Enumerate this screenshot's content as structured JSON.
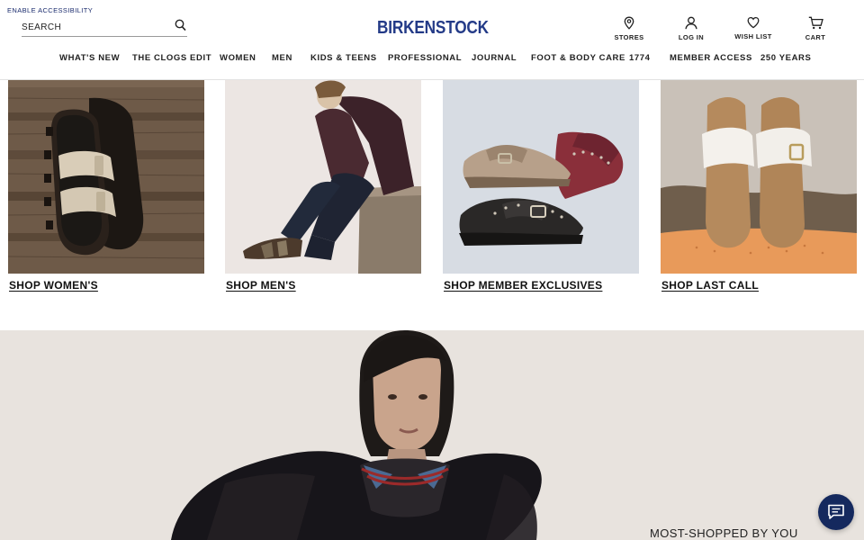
{
  "header": {
    "accessibility_link": "ENABLE ACCESSIBILITY",
    "search_placeholder": "SEARCH",
    "logo_text": "BIRKENSTOCK",
    "utility": [
      {
        "label": "STORES",
        "icon": "location-pin-icon"
      },
      {
        "label": "LOG IN",
        "icon": "user-icon"
      },
      {
        "label": "WISH LIST",
        "icon": "heart-icon"
      },
      {
        "label": "CART",
        "icon": "cart-icon"
      }
    ]
  },
  "nav": {
    "items": [
      "WHAT'S NEW",
      "THE CLOGS EDIT",
      "WOMEN",
      "MEN",
      "KIDS & TEENS",
      "PROFESSIONAL",
      "JOURNAL",
      "FOOT & BODY CARE",
      "1774",
      "MEMBER ACCESS",
      "250 YEARS"
    ]
  },
  "tiles": [
    {
      "cta": "SHOP WOMEN'S",
      "image": "cream two-strap sandal on wooden deck"
    },
    {
      "cta": "SHOP MEN'S",
      "image": "man seated in dark jacket and jeans"
    },
    {
      "cta": "SHOP MEMBER EXCLUSIVES",
      "image": "three studded suede clogs"
    },
    {
      "cta": "SHOP LAST CALL",
      "image": "white buckle sandals on cork"
    }
  ],
  "hero": {
    "heading": "MOST-SHOPPED BY YOU",
    "image": "woman in black leather bomber jacket"
  },
  "chat": {
    "icon": "chat-icon"
  },
  "colors": {
    "brand": "#233a87",
    "chat": "#15295e",
    "text": "#111111"
  }
}
